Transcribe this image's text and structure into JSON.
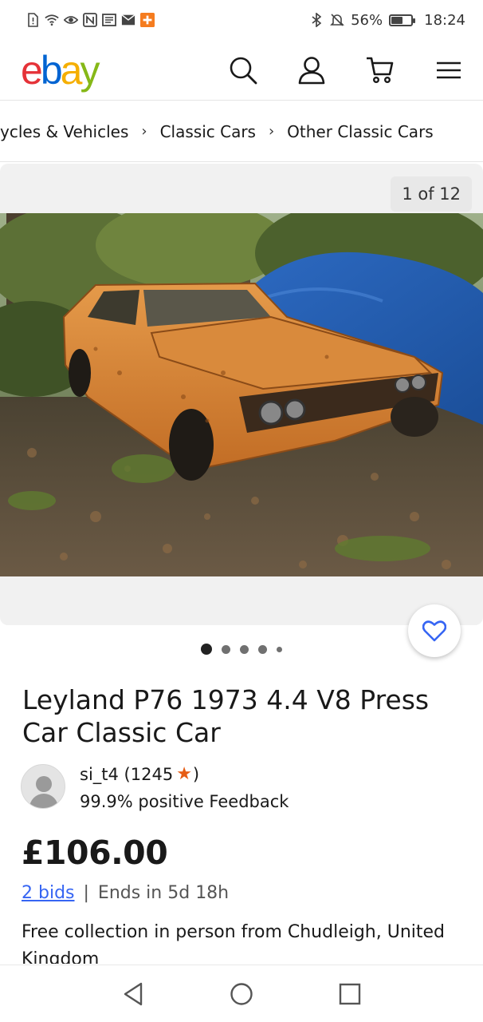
{
  "status_bar": {
    "battery": "56%",
    "battery_level": 0.56,
    "time": "18:24",
    "left_icons": [
      "sim-alert-icon",
      "wifi-icon",
      "eye-icon",
      "nfc-icon",
      "news-icon",
      "mail-icon",
      "plus-app-icon"
    ],
    "right_icons": [
      "bluetooth-icon",
      "mute-icon",
      "battery-icon"
    ]
  },
  "header": {
    "logo_letters": [
      "e",
      "b",
      "a",
      "y"
    ],
    "logo_colors": [
      "#e53238",
      "#0064d2",
      "#f5af02",
      "#86b817"
    ],
    "icons": [
      "search-icon",
      "account-icon",
      "cart-icon",
      "menu-icon"
    ]
  },
  "breadcrumb": {
    "items": [
      "ycles & Vehicles",
      "Classic Cars",
      "Other Classic Cars"
    ],
    "separator": "›"
  },
  "gallery": {
    "counter": "1 of 12",
    "image_alt": "Orange Leyland P76 body shell beside blue tarp in woodland",
    "dots": 5,
    "active_dot": 1
  },
  "listing": {
    "title": "Leyland P76 1973 4.4 V8 Press Car Classic Car",
    "seller_name": "si_t4 (1245",
    "seller_close": ")",
    "seller_feedback": "99.9% positive Feedback",
    "price": "£106.00",
    "bids": "2 bids",
    "bids_separator": "|",
    "ends": "Ends in 5d 18h",
    "delivery": "Free collection in person from Chudleigh, United Kingdom"
  },
  "colors": {
    "link": "#3665f3",
    "star": "#e65c14",
    "heart": "#3665f3"
  }
}
